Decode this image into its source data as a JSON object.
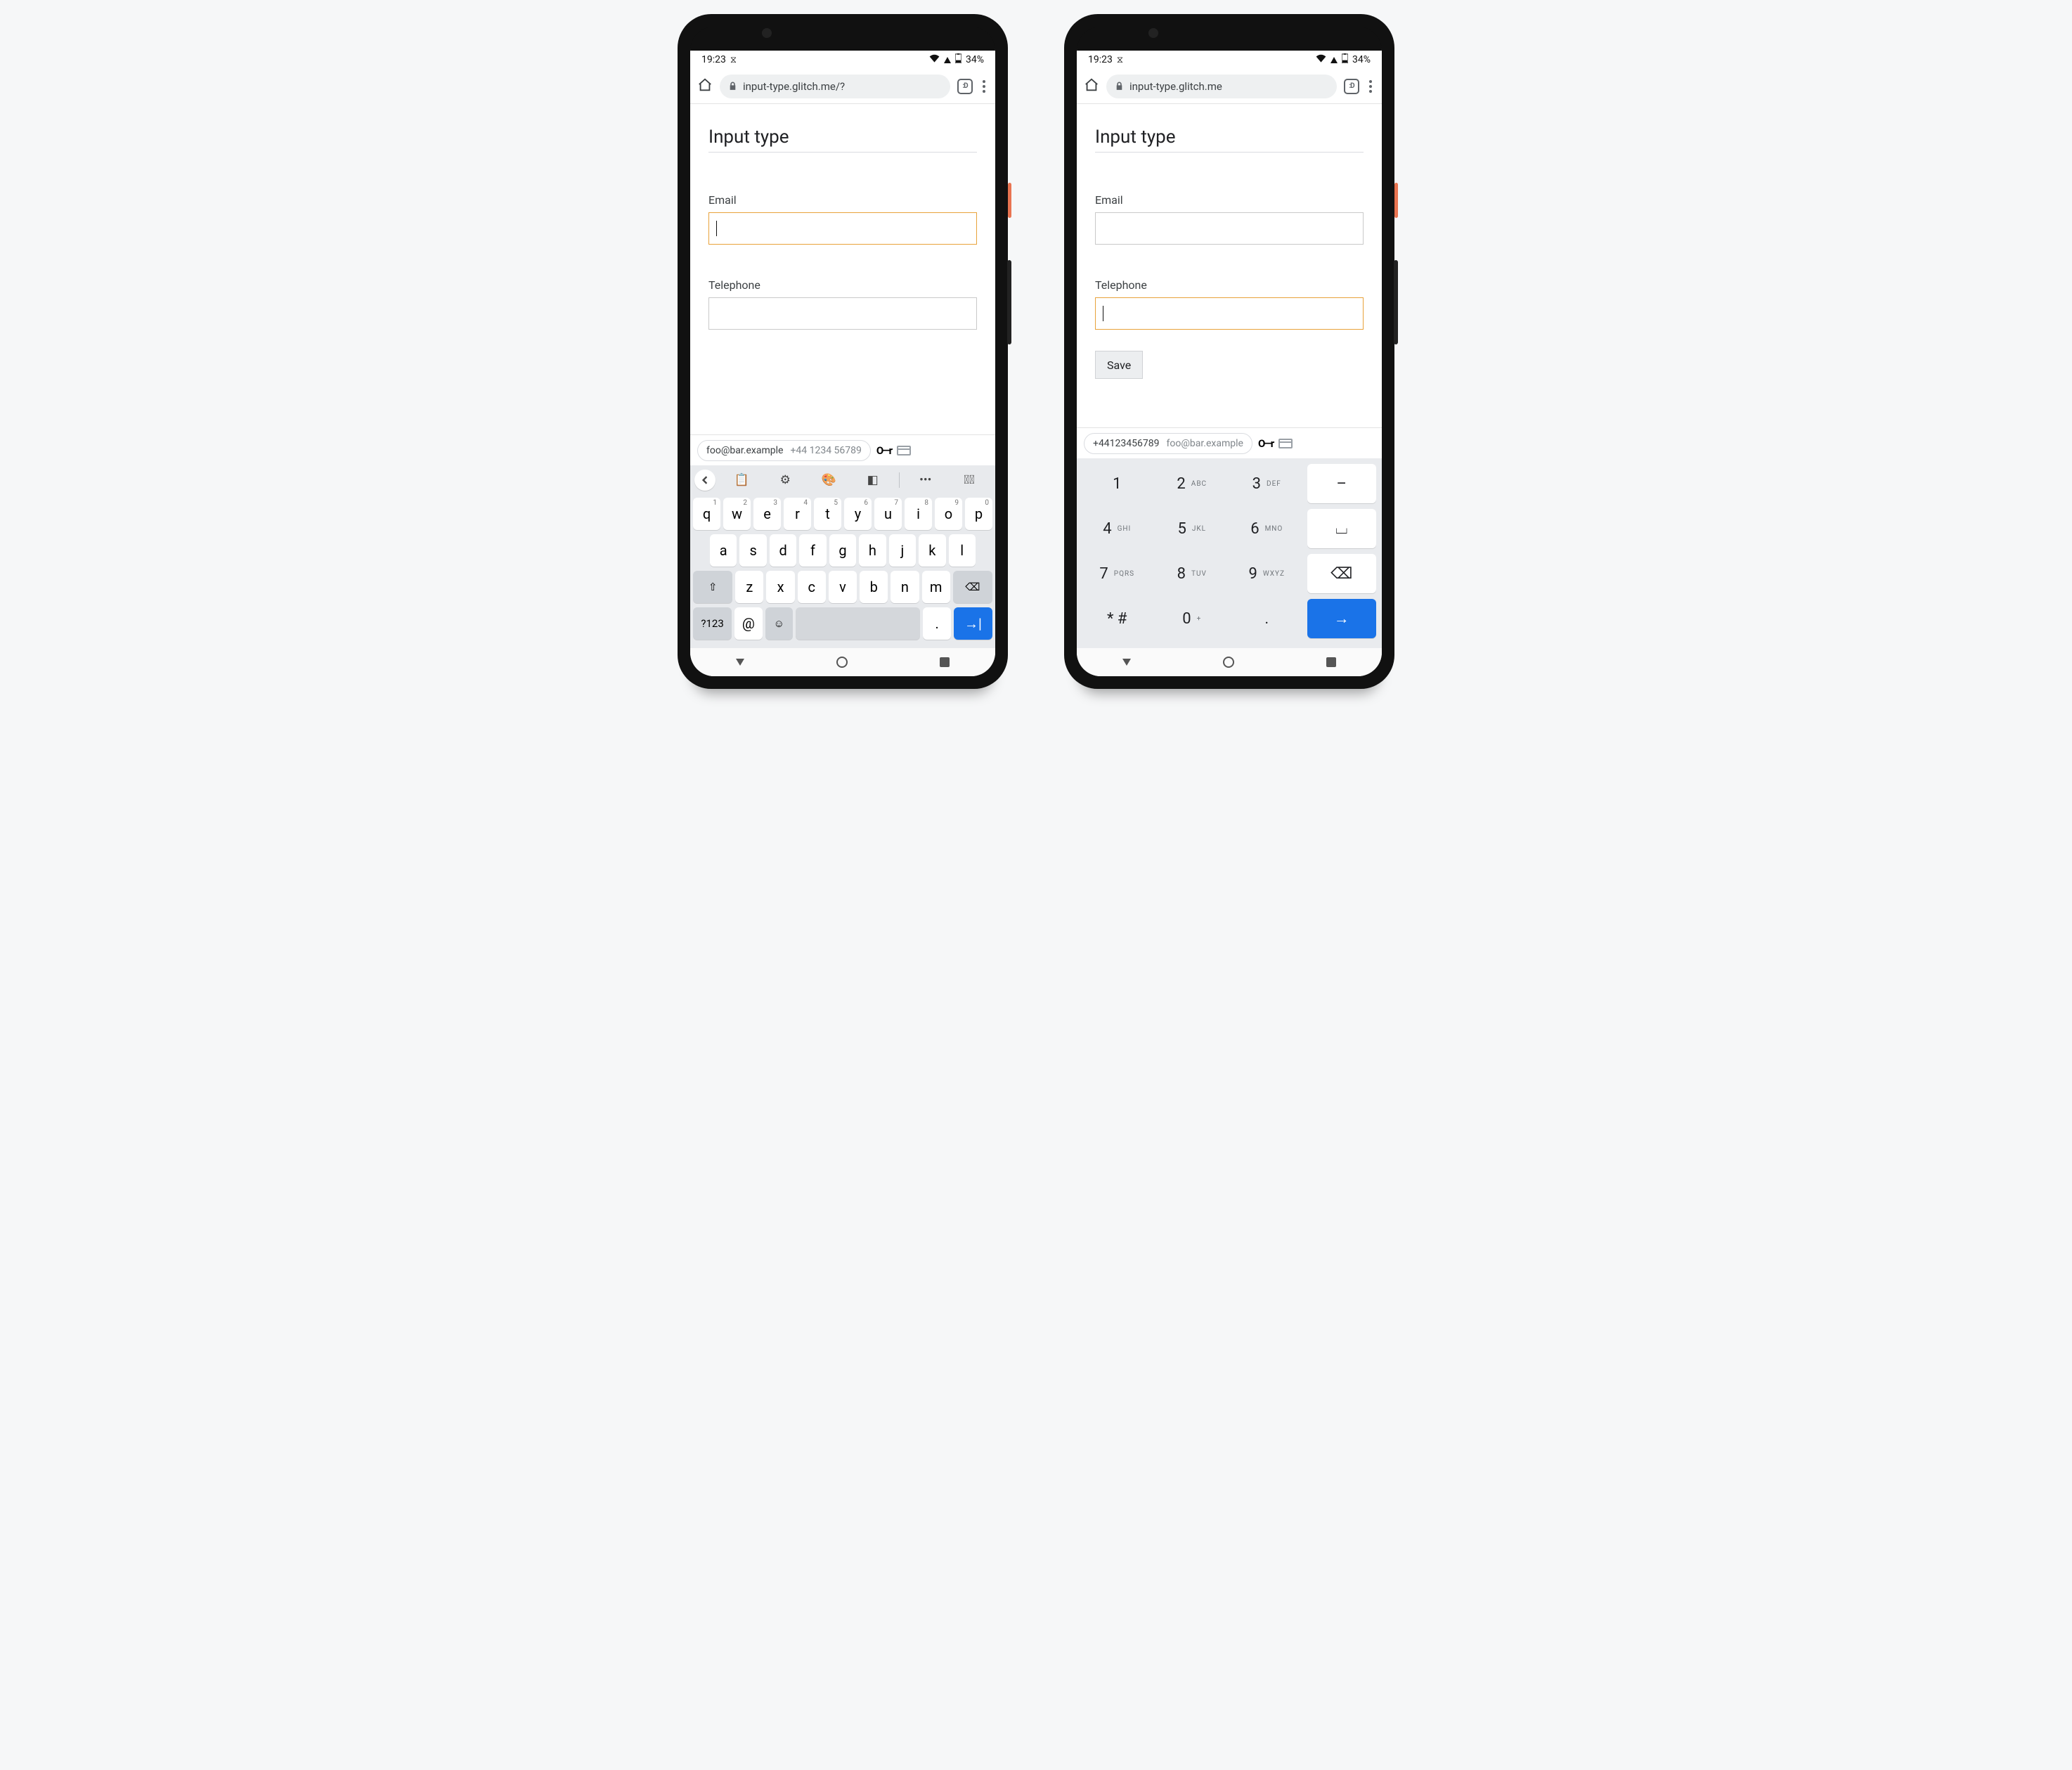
{
  "status": {
    "time": "19:23",
    "battery": "34%"
  },
  "browser": {
    "url_left": "input-type.glitch.me/?",
    "url_right": "input-type.glitch.me",
    "tab_badge": ":D"
  },
  "page": {
    "heading": "Input type",
    "email_label": "Email",
    "tel_label": "Telephone",
    "save_label": "Save"
  },
  "autofill": {
    "email_primary": "foo@bar.example",
    "email_secondary": "+44 1234 56789",
    "tel_primary": "+44123456789",
    "tel_secondary": "foo@bar.example"
  },
  "qwerty": {
    "r1": [
      [
        "q",
        "1"
      ],
      [
        "w",
        "2"
      ],
      [
        "e",
        "3"
      ],
      [
        "r",
        "4"
      ],
      [
        "t",
        "5"
      ],
      [
        "y",
        "6"
      ],
      [
        "u",
        "7"
      ],
      [
        "i",
        "8"
      ],
      [
        "o",
        "9"
      ],
      [
        "p",
        "0"
      ]
    ],
    "r2": [
      "a",
      "s",
      "d",
      "f",
      "g",
      "h",
      "j",
      "k",
      "l"
    ],
    "r3": [
      "z",
      "x",
      "c",
      "v",
      "b",
      "n",
      "m"
    ],
    "sym": "?123",
    "at": "@",
    "period": "."
  },
  "dial": {
    "grid": [
      [
        [
          "1",
          ""
        ],
        [
          "2",
          "ABC"
        ],
        [
          "3",
          "DEF"
        ]
      ],
      [
        [
          "4",
          "GHI"
        ],
        [
          "5",
          "JKL"
        ],
        [
          "6",
          "MNO"
        ]
      ],
      [
        [
          "7",
          "PQRS"
        ],
        [
          "8",
          "TUV"
        ],
        [
          "9",
          "WXYZ"
        ]
      ],
      [
        [
          "* #",
          ""
        ],
        [
          "0",
          "+"
        ],
        [
          ".",
          ""
        ]
      ]
    ],
    "ops": [
      "–",
      "⌴",
      "⌫",
      "→"
    ]
  }
}
